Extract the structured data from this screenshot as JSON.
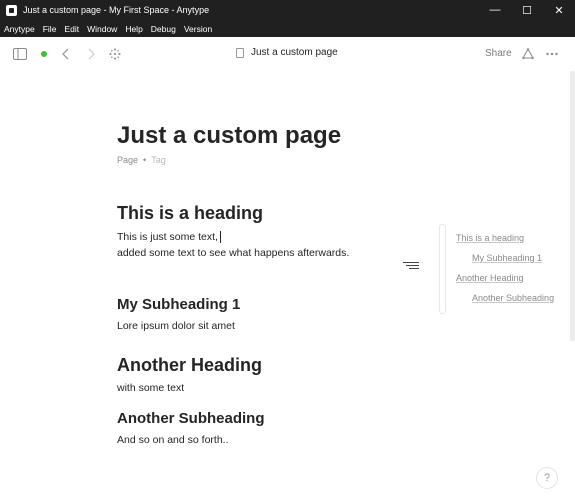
{
  "window": {
    "title": "Just a custom page - My First Space - Anytype",
    "controls": {
      "minimize": "—",
      "maximize": "☐",
      "close": "✕"
    }
  },
  "menubar": {
    "items": [
      "Anytype",
      "File",
      "Edit",
      "Window",
      "Help",
      "Debug",
      "Version"
    ]
  },
  "toolbar": {
    "page_title": "Just a custom page",
    "share_label": "Share",
    "sync_status_color": "#3ec12c",
    "icons": [
      "sidebar-toggle-icon",
      "back-arrow-icon",
      "forward-arrow-icon",
      "graph-icon",
      "document-icon",
      "widget-icon",
      "more-icon"
    ]
  },
  "page": {
    "title": "Just a custom page",
    "meta_type": "Page",
    "meta_separator": "•",
    "meta_tag": "Tag",
    "blocks": [
      {
        "kind": "h1",
        "text": "This is a heading"
      },
      {
        "kind": "p",
        "text": "This is just some text,"
      },
      {
        "kind": "p",
        "text": "added some text to see what happens afterwards."
      },
      {
        "kind": "h2",
        "text": "My Subheading 1"
      },
      {
        "kind": "p",
        "text": "Lore ipsum dolor sit amet"
      },
      {
        "kind": "h1",
        "text": "Another Heading"
      },
      {
        "kind": "p",
        "text": "with some text"
      },
      {
        "kind": "h2",
        "text": "Another Subheading"
      },
      {
        "kind": "p",
        "text": "And so on and so forth.."
      }
    ]
  },
  "toc": {
    "items": [
      {
        "label": "This is a heading",
        "level": 1
      },
      {
        "label": "My Subheading 1",
        "level": 2
      },
      {
        "label": "Another Heading",
        "level": 1
      },
      {
        "label": "Another Subheading",
        "level": 2
      }
    ]
  },
  "help": {
    "label": "?"
  }
}
